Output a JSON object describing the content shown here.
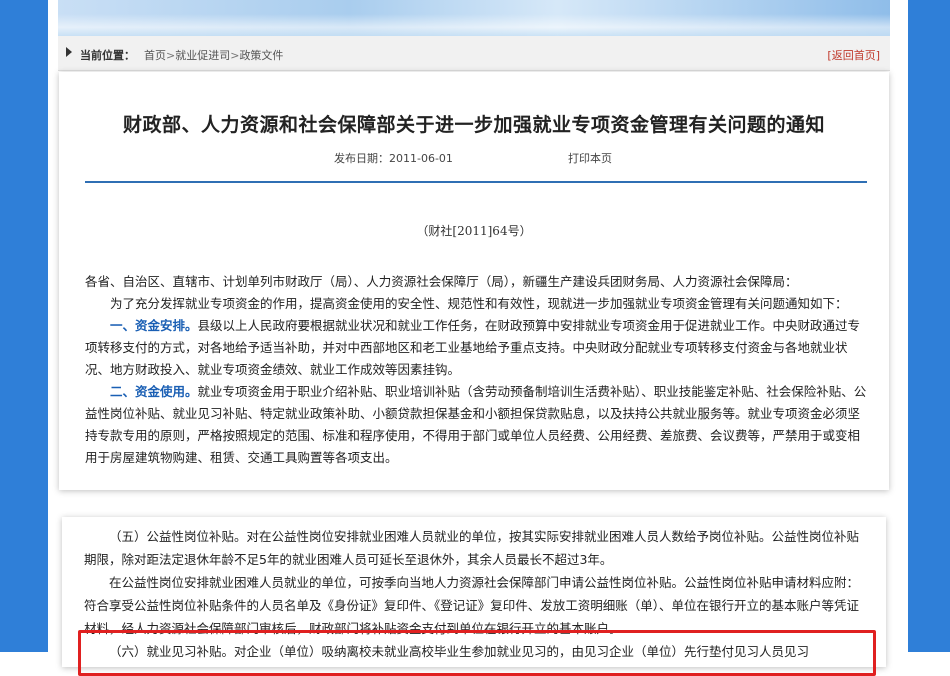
{
  "breadcrumb": {
    "label": "当前位置：",
    "items": [
      "首页",
      "就业促进司",
      "政策文件"
    ],
    "separator": ">",
    "back_home": "[返回首页]"
  },
  "article": {
    "title": "财政部、人力资源和社会保障部关于进一步加强就业专项资金管理有关问题的通知",
    "date_label": "发布日期：",
    "date": "2011-06-01",
    "print": "打印本页",
    "doc_number": "（财社[2011]64号）",
    "addressee": "各省、自治区、直辖市、计划单列市财政厅（局）、人力资源社会保障厅（局），新疆生产建设兵团财务局、人力资源社会保障局：",
    "intro": "为了充分发挥就业专项资金的作用，提高资金使用的安全性、规范性和有效性，现就进一步加强就业专项资金管理有关问题通知如下：",
    "section1_heading": "一、资金安排。",
    "section1_text": "县级以上人民政府要根据就业状况和就业工作任务，在财政预算中安排就业专项资金用于促进就业工作。中央财政通过专项转移支付的方式，对各地给予适当补助，并对中西部地区和老工业基地给予重点支持。中央财政分配就业专项转移支付资金与各地就业状况、地方财政投入、就业专项资金绩效、就业工作成效等因素挂钩。",
    "section2_heading": "二、资金使用。",
    "section2_text": "就业专项资金用于职业介绍补贴、职业培训补贴（含劳动预备制培训生活费补贴）、职业技能鉴定补贴、社会保险补贴、公益性岗位补贴、就业见习补贴、特定就业政策补助、小额贷款担保基金和小额担保贷款贴息，以及扶持公共就业服务等。就业专项资金必须坚持专款专用的原则，严格按照规定的范围、标准和程序使用，不得用于部门或单位人员经费、公用经费、差旅费、会议费等，严禁用于或变相用于房屋建筑物购建、租赁、交通工具购置等各项支出。"
  },
  "excerpt": {
    "para1": "（五）公益性岗位补贴。对在公益性岗位安排就业困难人员就业的单位，按其实际安排就业困难人员人数给予岗位补贴。公益性岗位补贴期限，除对距法定退休年龄不足5年的就业困难人员可延长至退休外，其余人员最长不超过3年。",
    "para2": "在公益性岗位安排就业困难人员就业的单位，可按季向当地人力资源社会保障部门申请公益性岗位补贴。公益性岗位补贴申请材料应附：符合享受公益性岗位补贴条件的人员名单及《身份证》复印件、《登记证》复印件、发放工资明细账（单）、单位在银行开立的基本账户等凭证材料，经人力资源社会保障部门审核后，财政部门将补贴资金支付到单位在银行开立的基本账户。",
    "para3": "（六）就业见习补贴。对企业（单位）吸纳离校未就业高校毕业生参加就业见习的，由见习企业（单位）先行垫付见习人员见习"
  },
  "colors": {
    "accent": "#2f7fd8",
    "heading_blue": "#1a5fb4",
    "highlight_red": "#e02020",
    "rule": "#2f6fb4"
  }
}
